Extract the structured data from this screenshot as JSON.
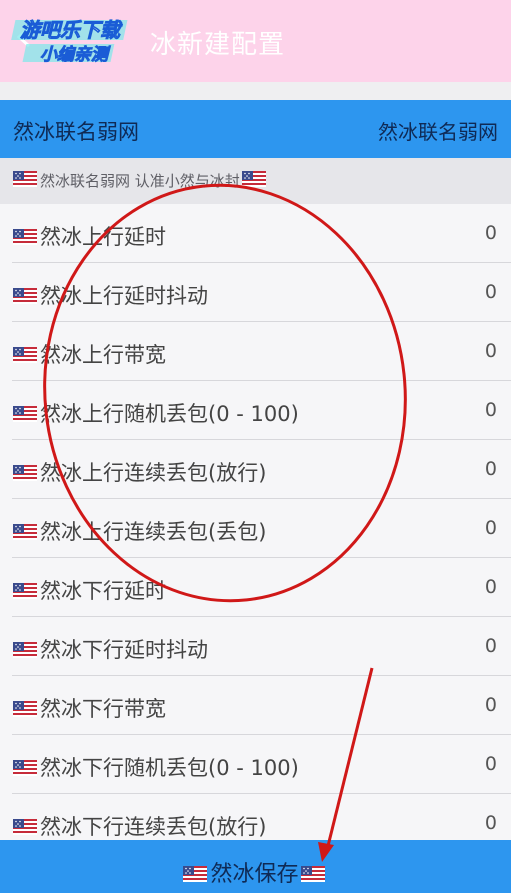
{
  "window": {
    "title": "冰新建配置",
    "watermark_line1": "游吧乐下载",
    "watermark_line2": "小编亲测"
  },
  "header": {
    "left": "然冰联名弱网",
    "right": "然冰联名弱网"
  },
  "notice": "然冰联名弱网 认准小然与冰封",
  "rows": [
    {
      "label": "然冰上行延时",
      "value": "0"
    },
    {
      "label": "然冰上行延时抖动",
      "value": "0"
    },
    {
      "label": "然冰上行带宽",
      "value": "0"
    },
    {
      "label": "然冰上行随机丢包(0 - 100)",
      "value": "0"
    },
    {
      "label": "然冰上行连续丢包(放行)",
      "value": "0"
    },
    {
      "label": "然冰上行连续丢包(丢包)",
      "value": "0"
    },
    {
      "label": "然冰下行延时",
      "value": "0"
    },
    {
      "label": "然冰下行延时抖动",
      "value": "0"
    },
    {
      "label": "然冰下行带宽",
      "value": "0"
    },
    {
      "label": "然冰下行随机丢包(0 - 100)",
      "value": "0"
    },
    {
      "label": "然冰下行连续丢包(放行)",
      "value": "0"
    }
  ],
  "save_label": "然冰保存",
  "colors": {
    "titlebar": "#fdd3ea",
    "accent": "#2d96ef",
    "annotation": "#d01818"
  }
}
